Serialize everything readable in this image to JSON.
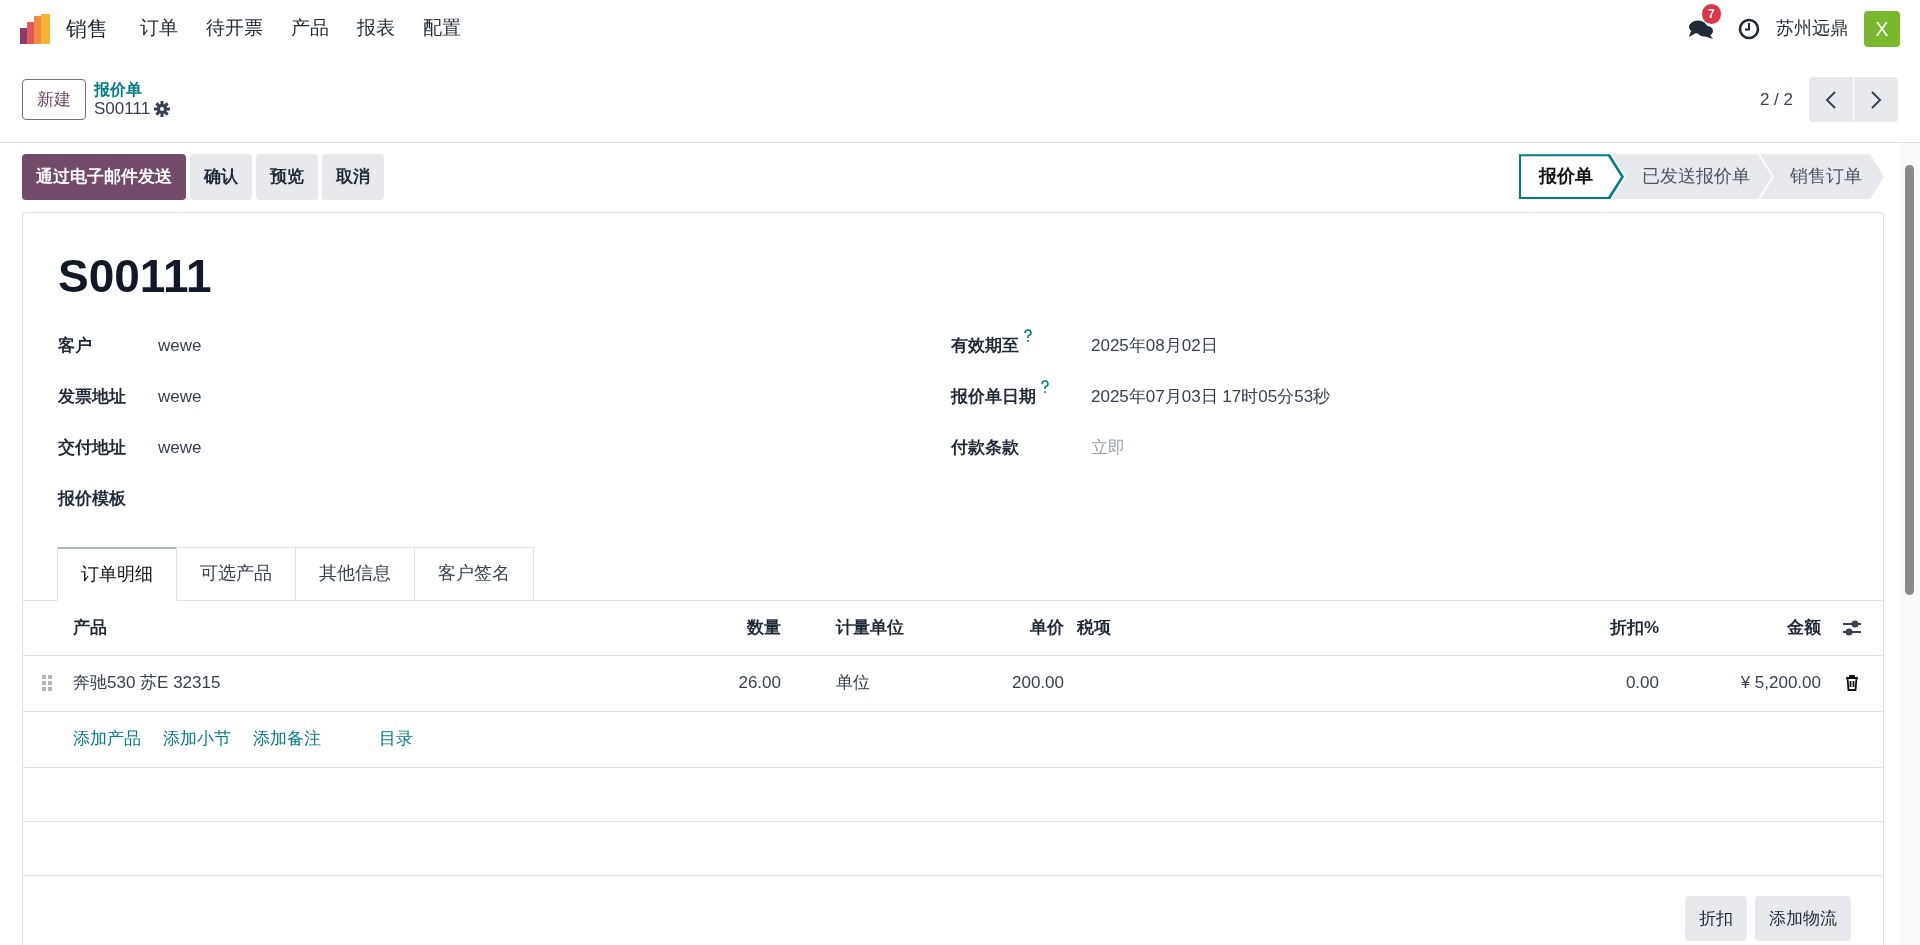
{
  "navbar": {
    "app_name": "销售",
    "menu": [
      "订单",
      "待开票",
      "产品",
      "报表",
      "配置"
    ],
    "messages_badge": "7",
    "company": "苏州远鼎",
    "avatar_letter": "X"
  },
  "control_panel": {
    "new_button": "新建",
    "breadcrumb": "报价单",
    "record_name": "S00111",
    "pager": "2 / 2"
  },
  "actions": [
    {
      "label": "通过电子邮件发送",
      "primary": true
    },
    {
      "label": "确认",
      "primary": false
    },
    {
      "label": "预览",
      "primary": false
    },
    {
      "label": "取消",
      "primary": false
    }
  ],
  "status_stages": [
    {
      "label": "报价单",
      "selected": true
    },
    {
      "label": "已发送报价单",
      "selected": false
    },
    {
      "label": "销售订单",
      "selected": false
    }
  ],
  "form": {
    "title": "S00111",
    "left_fields": [
      {
        "label": "客户",
        "value": "wewe",
        "help": false
      },
      {
        "label": "发票地址",
        "value": "wewe",
        "help": false
      },
      {
        "label": "交付地址",
        "value": "wewe",
        "help": false
      },
      {
        "label": "报价模板",
        "help": false
      }
    ],
    "right_fields": [
      {
        "label": "有效期至",
        "value": "2025年08月02日",
        "help": true
      },
      {
        "label": "报价单日期",
        "value": "2025年07月03日 17时05分53秒",
        "help": true
      },
      {
        "label": "付款条款",
        "placeholder": "立即",
        "help": false
      }
    ]
  },
  "tabs": [
    {
      "label": "订单明细",
      "selected": true
    },
    {
      "label": "可选产品",
      "selected": false
    },
    {
      "label": "其他信息",
      "selected": false
    },
    {
      "label": "客户签名",
      "selected": false
    }
  ],
  "order_lines": {
    "columns": [
      "产品",
      "数量",
      "计量单位",
      "单价",
      "税项",
      "折扣%",
      "金额"
    ],
    "rows": [
      {
        "product": "奔驰530 苏E 32315",
        "quantity": "26.00",
        "uom": "单位",
        "unit_price": "200.00",
        "discount": "0.00",
        "subtotal": "¥ 5,200.00"
      }
    ],
    "add_links": [
      "添加产品",
      "添加小节",
      "添加备注",
      "目录"
    ]
  },
  "footer_buttons": [
    "折扣",
    "添加物流"
  ]
}
